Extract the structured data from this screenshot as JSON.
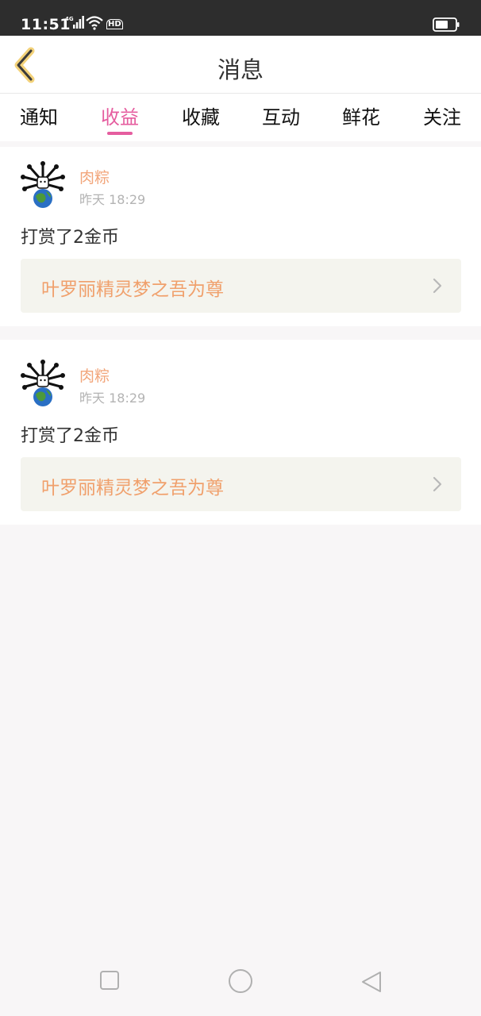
{
  "status_bar": {
    "time": "11:51",
    "network_label": "4G",
    "hd_label": "HD"
  },
  "header": {
    "title": "消息",
    "back_icon": "chevron-left-icon"
  },
  "tabs": [
    {
      "label": "通知",
      "active": false
    },
    {
      "label": "收益",
      "active": true
    },
    {
      "label": "收藏",
      "active": false
    },
    {
      "label": "互动",
      "active": false
    },
    {
      "label": "鲜花",
      "active": false
    },
    {
      "label": "关注",
      "active": false
    }
  ],
  "messages": [
    {
      "user": "肉粽",
      "time": "昨天 18:29",
      "text": "打赏了2金币",
      "book_title": "叶罗丽精灵梦之吾为尊"
    },
    {
      "user": "肉粽",
      "time": "昨天 18:29",
      "text": "打赏了2金币",
      "book_title": "叶罗丽精灵梦之吾为尊"
    }
  ],
  "colors": {
    "accent": "#e55d9f",
    "username": "#f2a57a",
    "link_text": "#f0a06c",
    "back_icon": "#f3d27a"
  },
  "nav_bar": {
    "icons": [
      "recent-apps-icon",
      "home-icon",
      "back-triangle-icon"
    ]
  }
}
